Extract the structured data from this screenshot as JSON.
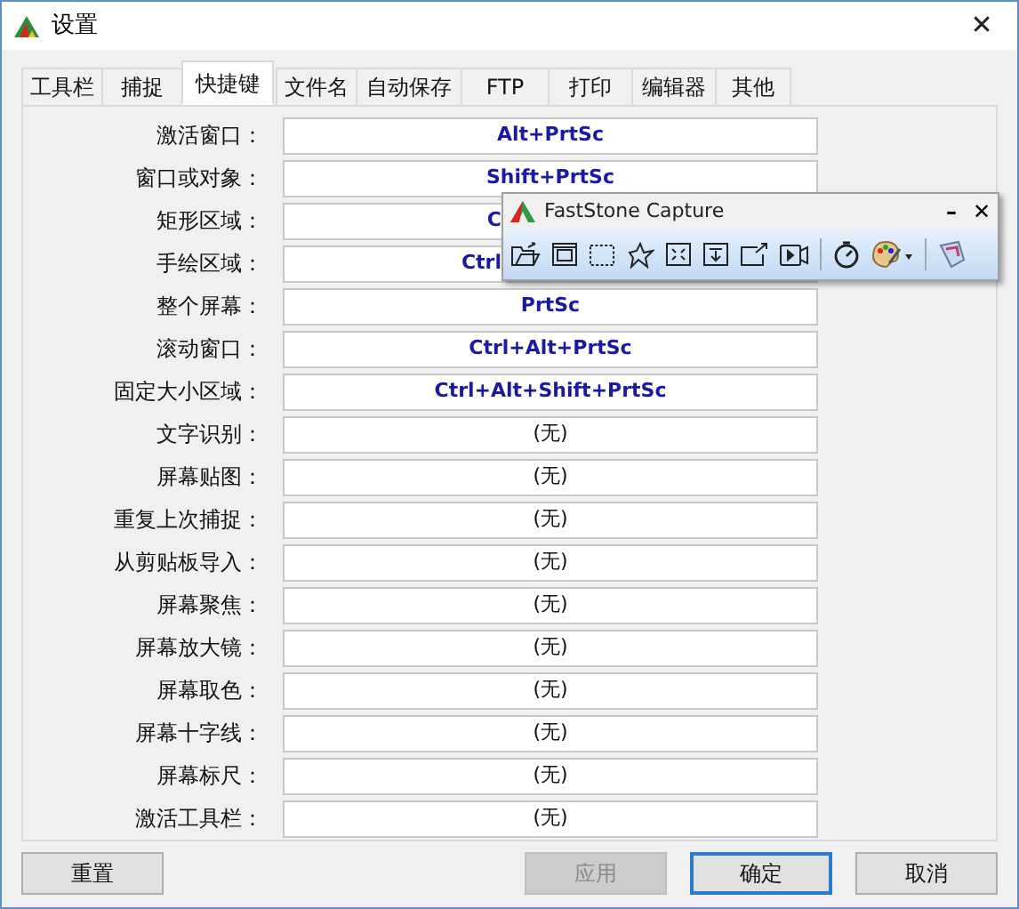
{
  "window": {
    "title": "设置",
    "close": "✕"
  },
  "tabs": [
    {
      "label": "工具栏",
      "selected": false
    },
    {
      "label": "捕捉",
      "selected": false
    },
    {
      "label": "快捷键",
      "selected": true
    },
    {
      "label": "文件名",
      "selected": false
    },
    {
      "label": "自动保存",
      "selected": false
    },
    {
      "label": "FTP",
      "selected": false
    },
    {
      "label": "打印",
      "selected": false
    },
    {
      "label": "编辑器",
      "selected": false
    },
    {
      "label": "其他",
      "selected": false
    }
  ],
  "hotkeys": [
    {
      "label": "激活窗口：",
      "value": "Alt+PrtSc",
      "kind": "full"
    },
    {
      "label": "窗口或对象：",
      "value": "Shift+PrtSc",
      "kind": "full"
    },
    {
      "label": "矩形区域：",
      "value": "C",
      "kind": "cut"
    },
    {
      "label": "手绘区域：",
      "value": "Ctrl",
      "kind": "cut"
    },
    {
      "label": "整个屏幕：",
      "value": "PrtSc",
      "kind": "full"
    },
    {
      "label": "滚动窗口：",
      "value": "Ctrl+Alt+PrtSc",
      "kind": "full"
    },
    {
      "label": "固定大小区域：",
      "value": "Ctrl+Alt+Shift+PrtSc",
      "kind": "full"
    },
    {
      "label": "文字识别：",
      "value": "(无)",
      "kind": "none"
    },
    {
      "label": "屏幕贴图：",
      "value": "(无)",
      "kind": "none"
    },
    {
      "label": "重复上次捕捉：",
      "value": "(无)",
      "kind": "none"
    },
    {
      "label": "从剪贴板导入：",
      "value": "(无)",
      "kind": "none"
    },
    {
      "label": "屏幕聚焦：",
      "value": "(无)",
      "kind": "none"
    },
    {
      "label": "屏幕放大镜：",
      "value": "(无)",
      "kind": "none"
    },
    {
      "label": "屏幕取色：",
      "value": "(无)",
      "kind": "none"
    },
    {
      "label": "屏幕十字线：",
      "value": "(无)",
      "kind": "none"
    },
    {
      "label": "屏幕标尺：",
      "value": "(无)",
      "kind": "none"
    },
    {
      "label": "激活工具栏：",
      "value": "(无)",
      "kind": "none"
    }
  ],
  "buttons": [
    {
      "label": "重置",
      "disabled": false,
      "focused": false
    },
    {
      "label": "应用",
      "disabled": true,
      "focused": false
    },
    {
      "label": "确定",
      "disabled": false,
      "focused": true
    },
    {
      "label": "取消",
      "disabled": false,
      "focused": false
    }
  ],
  "capture_toolbar": {
    "title": "FastStone Capture",
    "minimize": "–",
    "close": "✕"
  }
}
